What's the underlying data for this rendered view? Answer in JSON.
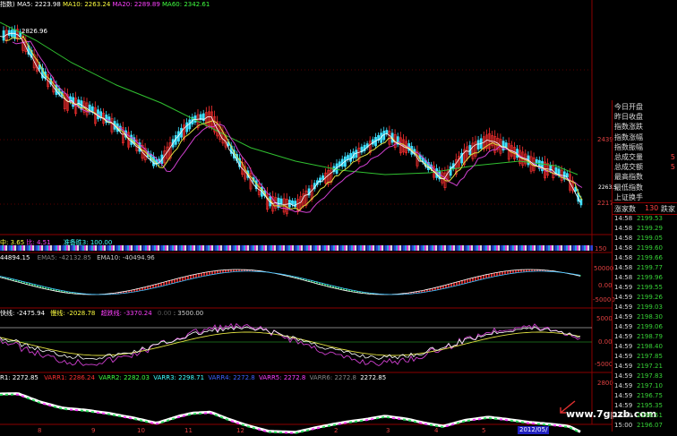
{
  "main_legend": {
    "name": "指数)",
    "ma5": "MA5: 2223.98",
    "ma10": "MA10: 2263.24",
    "ma20": "MA20: 2289.89",
    "ma60": "MA60: 2342.61"
  },
  "main_chart": {
    "peak_label": "2826.96",
    "axis_labels": [
      "2439",
      "2263.5",
      "2217"
    ]
  },
  "info_panel": {
    "labels": [
      "今日开盘",
      "昨日收盘",
      "指数涨跌",
      "指数涨幅",
      "指数振幅",
      "总成交量",
      "总成交额",
      "最高指数",
      "最低指数",
      "上证换手"
    ],
    "values": [
      "",
      "",
      "",
      "",
      "",
      "5",
      "5",
      "",
      "",
      ""
    ],
    "rise_label": "涨家数",
    "rise_value": "130",
    "fall_label": "跌家"
  },
  "ticks": {
    "rows": [
      {
        "time": "14:58",
        "price": "2199.53"
      },
      {
        "time": "14:58",
        "price": "2199.29"
      },
      {
        "time": "14:58",
        "price": "2199.05"
      },
      {
        "time": "14:58",
        "price": "2199.60"
      },
      {
        "time": "14:58",
        "price": "2199.66"
      },
      {
        "time": "14:58",
        "price": "2199.77"
      },
      {
        "time": "14:58",
        "price": "2199.96"
      },
      {
        "time": "14:59",
        "price": "2199.55"
      },
      {
        "time": "14:59",
        "price": "2199.26"
      },
      {
        "time": "14:59",
        "price": "2199.03"
      },
      {
        "time": "14:59",
        "price": "2198.30"
      },
      {
        "time": "14:59",
        "price": "2199.06"
      },
      {
        "time": "14:59",
        "price": "2198.79"
      },
      {
        "time": "14:59",
        "price": "2198.40"
      },
      {
        "time": "14:59",
        "price": "2197.85"
      },
      {
        "time": "14:59",
        "price": "2197.21"
      },
      {
        "time": "14:59",
        "price": "2197.83"
      },
      {
        "time": "14:59",
        "price": "2197.10"
      },
      {
        "time": "14:59",
        "price": "2196.75"
      },
      {
        "time": "14:59",
        "price": "2195.35"
      },
      {
        "time": "14:59",
        "price": "2196.51"
      },
      {
        "time": "15:00",
        "price": "2196.07"
      }
    ]
  },
  "strip": {
    "prefix": "中: 3.65",
    "b": "比: 4.51",
    "c": "准备胜3: 100.00",
    "axis": "150"
  },
  "panel2": {
    "legend_a": "44894.15",
    "ema5": "EMA5: -42132.85",
    "ema10": "EMA10: -40494.96",
    "axis_top": "50000",
    "axis_mid": "0.00",
    "axis_bot": "-50000"
  },
  "panel3": {
    "a": "快线: -2475.94",
    "b": "慢线: -2028.78",
    "c": "超跌线: -3370.24",
    "d": "0.00",
    "e": ": 3500.00",
    "axis_top": "5000",
    "axis_mid": "0.00",
    "axis_bot": "-5000"
  },
  "panel4": {
    "r": "R1: 2272.85",
    "v1": "VARR1: 2286.24",
    "v2": "VARR2: 2282.03",
    "v3": "VARR3: 2298.71",
    "v4": "VARR4: 2272.8",
    "v5": "VARR5: 2272.8",
    "v6": "VARR6: 2272.8",
    "v7": "2272.85",
    "axis": "2800"
  },
  "x_axis": {
    "labels": [
      "8",
      "9",
      "10",
      "11",
      "12",
      "2",
      "3",
      "4",
      "5"
    ],
    "last": "2012/05/"
  },
  "watermark": "www.7gpzb.com"
}
